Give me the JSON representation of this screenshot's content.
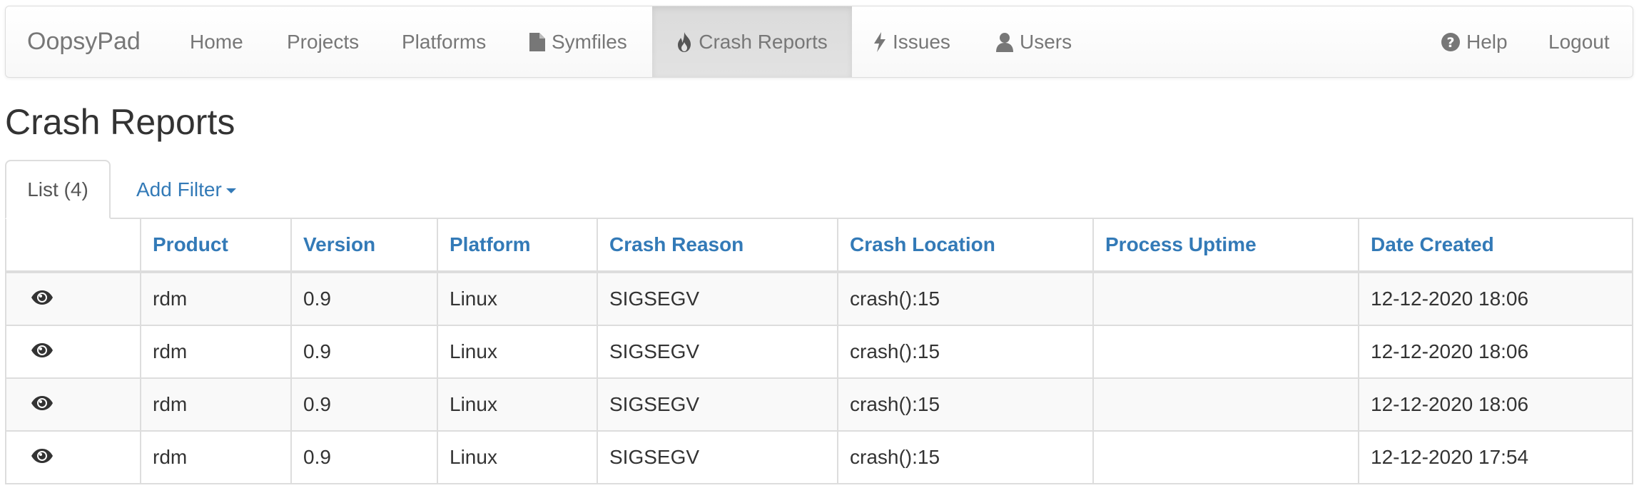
{
  "navbar": {
    "brand": "OopsyPad",
    "items": [
      {
        "label": "Home",
        "icon": ""
      },
      {
        "label": "Projects",
        "icon": ""
      },
      {
        "label": "Platforms",
        "icon": ""
      },
      {
        "label": "Symfiles",
        "icon": "file-icon"
      },
      {
        "label": "Crash Reports",
        "icon": "fire-icon",
        "active": true
      },
      {
        "label": "Issues",
        "icon": "flash-icon"
      },
      {
        "label": "Users",
        "icon": "user-icon"
      }
    ],
    "right": {
      "help": "Help",
      "logout": "Logout"
    }
  },
  "page": {
    "title": "Crash Reports"
  },
  "tabs": {
    "list": "List (4)",
    "add_filter": "Add Filter"
  },
  "table": {
    "columns": [
      "",
      "Product",
      "Version",
      "Platform",
      "Crash Reason",
      "Crash Location",
      "Process Uptime",
      "Date Created"
    ],
    "rows": [
      {
        "product": "rdm",
        "version": "0.9",
        "platform": "Linux",
        "crash_reason": "SIGSEGV",
        "crash_location": "crash():15",
        "process_uptime": "",
        "date_created": "12-12-2020 18:06"
      },
      {
        "product": "rdm",
        "version": "0.9",
        "platform": "Linux",
        "crash_reason": "SIGSEGV",
        "crash_location": "crash():15",
        "process_uptime": "",
        "date_created": "12-12-2020 18:06"
      },
      {
        "product": "rdm",
        "version": "0.9",
        "platform": "Linux",
        "crash_reason": "SIGSEGV",
        "crash_location": "crash():15",
        "process_uptime": "",
        "date_created": "12-12-2020 18:06"
      },
      {
        "product": "rdm",
        "version": "0.9",
        "platform": "Linux",
        "crash_reason": "SIGSEGV",
        "crash_location": "crash():15",
        "process_uptime": "",
        "date_created": "12-12-2020 17:54"
      }
    ]
  },
  "colors": {
    "link": "#337ab7",
    "nav_text": "#777777",
    "border": "#dddddd",
    "stripe": "#f9f9f9",
    "active_nav": "#e7e7e7"
  }
}
